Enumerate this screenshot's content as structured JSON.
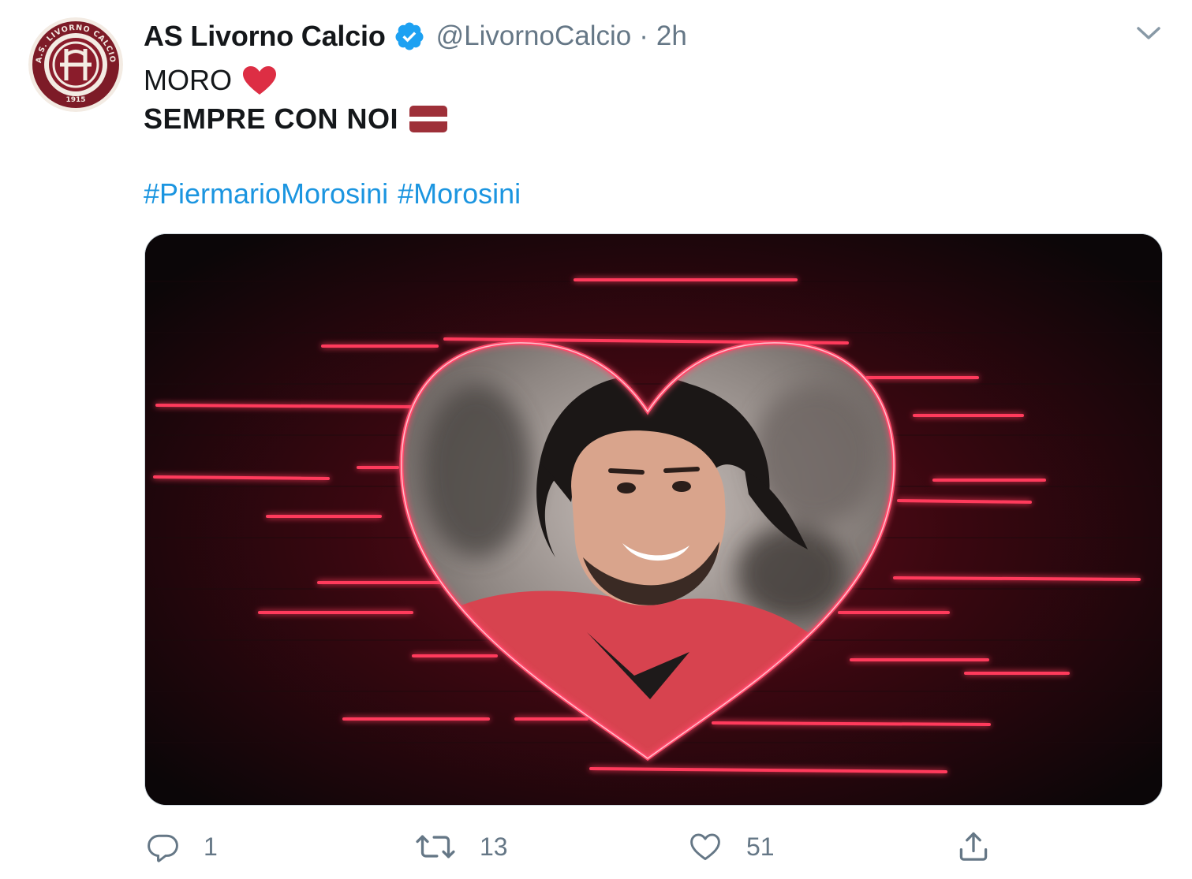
{
  "tweet": {
    "display_name": "AS Livorno Calcio",
    "handle": "@LivornoCalcio",
    "separator": "·",
    "time": "2h",
    "text_line1": "MORO",
    "text_line2": "SEMPRE CON NOI",
    "hashtags": [
      "#PiermarioMorosini",
      "#Morosini"
    ],
    "avatar_text": {
      "ring_top": "A.S. LIVORNO CALCIO",
      "year": "1915"
    }
  },
  "actions": {
    "reply_count": "1",
    "retweet_count": "13",
    "like_count": "51"
  },
  "icons": {
    "verified": "verified-badge-icon",
    "caret": "chevron-down-icon",
    "heart_emoji": "red-heart-emoji",
    "flag_emoji": "latvia-flag-emoji",
    "reply": "reply-icon",
    "retweet": "retweet-icon",
    "like": "like-heart-icon",
    "share": "share-icon"
  },
  "colors": {
    "hashtag": "#1b95e0",
    "secondary_text": "#657786",
    "verified": "#1da1f2",
    "club_maroon": "#8a1c2b",
    "neon": "#ff2d55"
  }
}
